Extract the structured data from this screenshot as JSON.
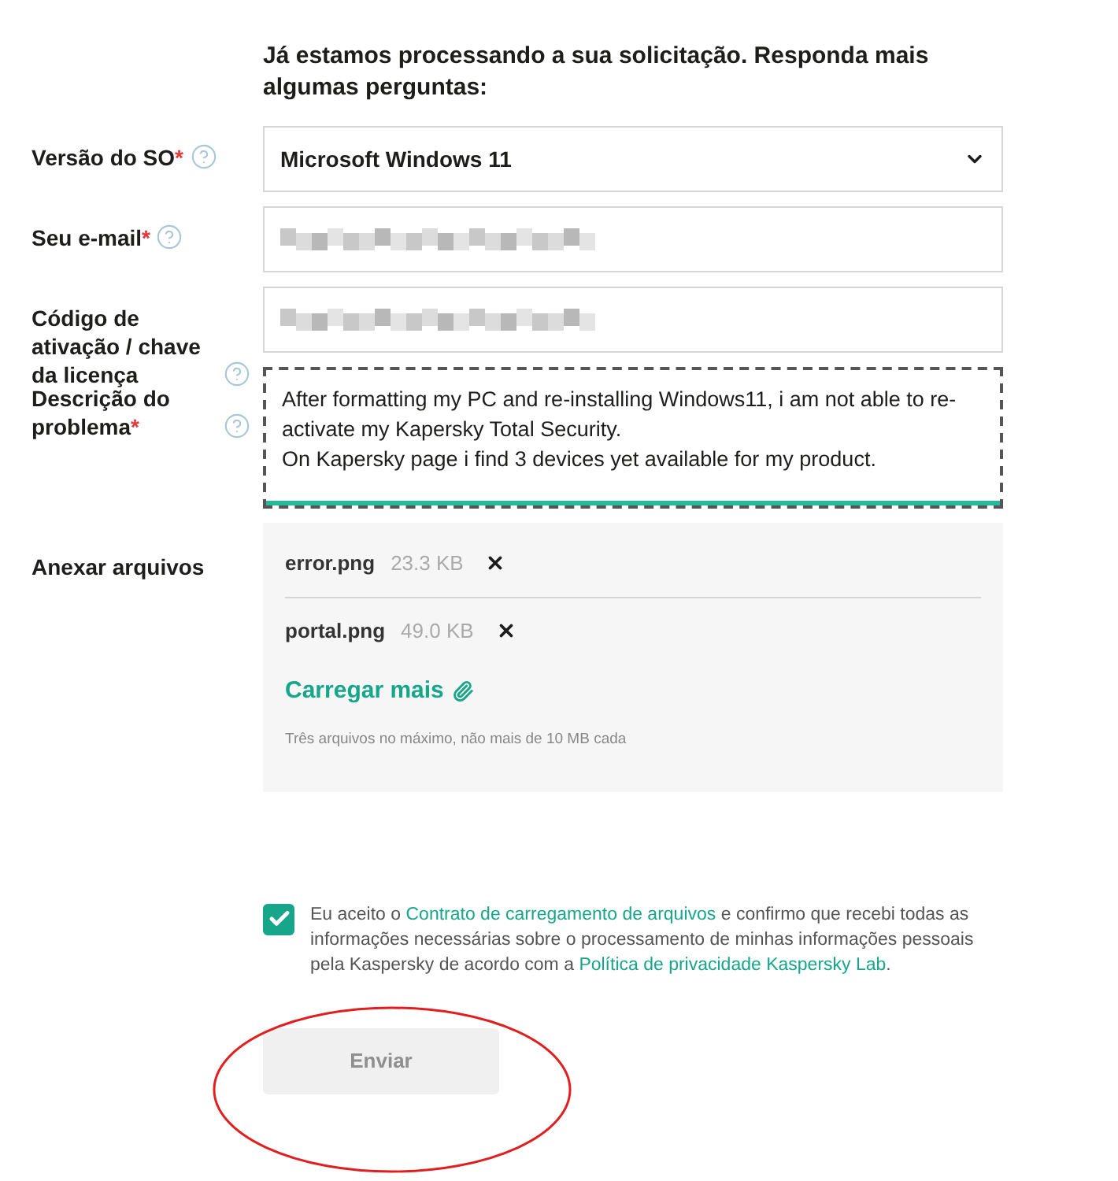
{
  "heading": "Já estamos processando a sua solicitação. Responda mais algumas perguntas:",
  "fields": [
    {
      "kind": "select",
      "label": "Versão do SO",
      "asterisk": "*",
      "help": true,
      "value": "Microsoft Windows 11"
    },
    {
      "kind": "input",
      "label": "Seu e-mail",
      "asterisk": "*",
      "help": true,
      "redacted": true
    },
    {
      "kind": "input",
      "label": "Código de ativação / chave da licença",
      "help": true,
      "redacted": true
    },
    {
      "kind": "textarea",
      "label": "Descrição do problema",
      "asterisk": "*",
      "help": true,
      "focused": true,
      "value": "After formatting my PC and re-installing Windows11, i am not able to re-activate my Kapersky Total Security.\nOn Kapersky page i find 3 devices yet available for my product."
    }
  ],
  "attachments": {
    "label": "Anexar arquivos",
    "files": [
      {
        "name": "error.png",
        "size": "23.3 KB"
      },
      {
        "name": "portal.png",
        "size": "49.0 KB"
      }
    ],
    "upload_link": "Carregar mais",
    "hint": "Três arquivos no máximo, não mais de 10 MB cada"
  },
  "agreement": {
    "checked": true,
    "parts": [
      {
        "kind": "text",
        "text": "Eu aceito o"
      },
      {
        "kind": "link",
        "text": "Contrato de carregamento de arquivos"
      },
      {
        "kind": "text",
        "text": "e confirmo que recebi todas as informações necessárias sobre o processamento de minhas informações pessoais pela Kaspersky de acordo com a"
      },
      {
        "kind": "link",
        "text": "Política de privacidade Kaspersky Lab"
      },
      {
        "kind": "text",
        "text": "."
      }
    ]
  },
  "submit": {
    "label": "Enviar",
    "disabled": true,
    "annotated": true
  }
}
